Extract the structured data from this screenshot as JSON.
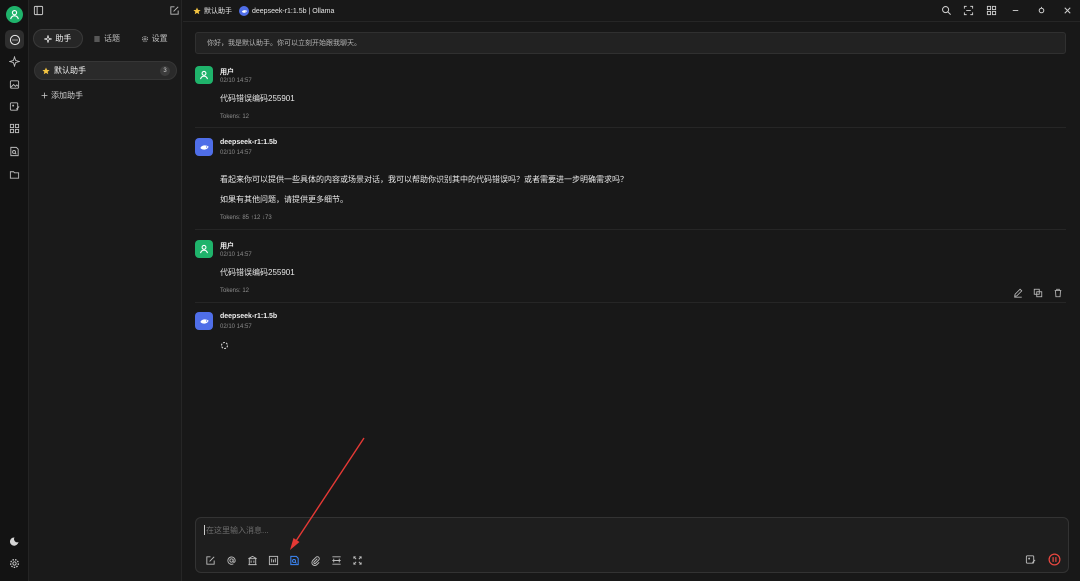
{
  "sidebar": {
    "tabs": [
      {
        "label": "助手"
      },
      {
        "label": "话题"
      },
      {
        "label": "设置"
      }
    ],
    "assistant": {
      "label": "默认助手",
      "count": "3"
    },
    "add_label": "添加助手"
  },
  "header": {
    "assistant_name": "默认助手",
    "model_label": "deepseek-r1:1.5b | Ollama"
  },
  "chat": {
    "notice": "你好，我是默认助手。你可以立刻开始跟我聊天。",
    "messages": [
      {
        "name": "用户",
        "time": "02/10 14:57",
        "text": "代码错误编码255901",
        "tokens": "Tokens: 12"
      },
      {
        "name": "deepseek-r1:1.5b",
        "time": "02/10 14:57",
        "text1": "看起来你可以提供一些具体的内容或场景对话，我可以帮助你识别其中的代码错误吗？或者需要进一步明确需求吗？",
        "text2": "如果有其他问题，请提供更多细节。",
        "tokens": "Tokens: 85 ↑12 ↓73"
      },
      {
        "name": "用户",
        "time": "02/10 14:57",
        "text": "代码错误编码255901",
        "tokens": "Tokens: 12"
      },
      {
        "name": "deepseek-r1:1.5b",
        "time": "02/10 14:57"
      }
    ]
  },
  "input": {
    "placeholder": "在这里输入消息..."
  },
  "colors": {
    "accent_green": "#1fb36b",
    "model_blue": "#4f6ee8",
    "highlight_tool": "#3d8bff",
    "stop_red": "#e8473f",
    "annotation_arrow": "#e53935"
  }
}
